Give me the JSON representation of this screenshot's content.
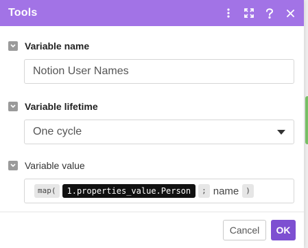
{
  "dialog": {
    "title": "Tools",
    "header_icons": [
      "more-vertical-icon",
      "expand-icon",
      "help-icon",
      "close-icon"
    ]
  },
  "fields": {
    "variable_name": {
      "label": "Variable name",
      "value": "Notion User Names"
    },
    "variable_lifetime": {
      "label": "Variable lifetime",
      "value": "One cycle"
    },
    "variable_value": {
      "label": "Variable value",
      "tokens": {
        "fn_open": "map(",
        "path": "1.properties_value.Person",
        "sep": ";",
        "key": "name",
        "fn_close": ")"
      }
    }
  },
  "footer": {
    "cancel_label": "Cancel",
    "ok_label": "OK"
  },
  "colors": {
    "titlebar": "#a273e6",
    "ok_button": "#7d4fd1",
    "token_dark": "#111111",
    "token_light": "#e6e6e6"
  }
}
